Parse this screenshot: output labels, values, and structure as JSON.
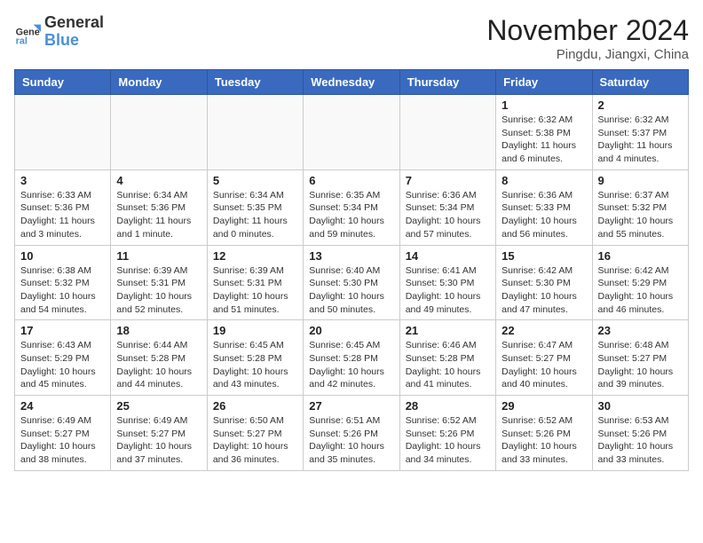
{
  "header": {
    "logo_general": "General",
    "logo_blue": "Blue",
    "month_title": "November 2024",
    "location": "Pingdu, Jiangxi, China"
  },
  "days_of_week": [
    "Sunday",
    "Monday",
    "Tuesday",
    "Wednesday",
    "Thursday",
    "Friday",
    "Saturday"
  ],
  "weeks": [
    [
      {
        "day": "",
        "info": ""
      },
      {
        "day": "",
        "info": ""
      },
      {
        "day": "",
        "info": ""
      },
      {
        "day": "",
        "info": ""
      },
      {
        "day": "",
        "info": ""
      },
      {
        "day": "1",
        "info": "Sunrise: 6:32 AM\nSunset: 5:38 PM\nDaylight: 11 hours and 6 minutes."
      },
      {
        "day": "2",
        "info": "Sunrise: 6:32 AM\nSunset: 5:37 PM\nDaylight: 11 hours and 4 minutes."
      }
    ],
    [
      {
        "day": "3",
        "info": "Sunrise: 6:33 AM\nSunset: 5:36 PM\nDaylight: 11 hours and 3 minutes."
      },
      {
        "day": "4",
        "info": "Sunrise: 6:34 AM\nSunset: 5:36 PM\nDaylight: 11 hours and 1 minute."
      },
      {
        "day": "5",
        "info": "Sunrise: 6:34 AM\nSunset: 5:35 PM\nDaylight: 11 hours and 0 minutes."
      },
      {
        "day": "6",
        "info": "Sunrise: 6:35 AM\nSunset: 5:34 PM\nDaylight: 10 hours and 59 minutes."
      },
      {
        "day": "7",
        "info": "Sunrise: 6:36 AM\nSunset: 5:34 PM\nDaylight: 10 hours and 57 minutes."
      },
      {
        "day": "8",
        "info": "Sunrise: 6:36 AM\nSunset: 5:33 PM\nDaylight: 10 hours and 56 minutes."
      },
      {
        "day": "9",
        "info": "Sunrise: 6:37 AM\nSunset: 5:32 PM\nDaylight: 10 hours and 55 minutes."
      }
    ],
    [
      {
        "day": "10",
        "info": "Sunrise: 6:38 AM\nSunset: 5:32 PM\nDaylight: 10 hours and 54 minutes."
      },
      {
        "day": "11",
        "info": "Sunrise: 6:39 AM\nSunset: 5:31 PM\nDaylight: 10 hours and 52 minutes."
      },
      {
        "day": "12",
        "info": "Sunrise: 6:39 AM\nSunset: 5:31 PM\nDaylight: 10 hours and 51 minutes."
      },
      {
        "day": "13",
        "info": "Sunrise: 6:40 AM\nSunset: 5:30 PM\nDaylight: 10 hours and 50 minutes."
      },
      {
        "day": "14",
        "info": "Sunrise: 6:41 AM\nSunset: 5:30 PM\nDaylight: 10 hours and 49 minutes."
      },
      {
        "day": "15",
        "info": "Sunrise: 6:42 AM\nSunset: 5:30 PM\nDaylight: 10 hours and 47 minutes."
      },
      {
        "day": "16",
        "info": "Sunrise: 6:42 AM\nSunset: 5:29 PM\nDaylight: 10 hours and 46 minutes."
      }
    ],
    [
      {
        "day": "17",
        "info": "Sunrise: 6:43 AM\nSunset: 5:29 PM\nDaylight: 10 hours and 45 minutes."
      },
      {
        "day": "18",
        "info": "Sunrise: 6:44 AM\nSunset: 5:28 PM\nDaylight: 10 hours and 44 minutes."
      },
      {
        "day": "19",
        "info": "Sunrise: 6:45 AM\nSunset: 5:28 PM\nDaylight: 10 hours and 43 minutes."
      },
      {
        "day": "20",
        "info": "Sunrise: 6:45 AM\nSunset: 5:28 PM\nDaylight: 10 hours and 42 minutes."
      },
      {
        "day": "21",
        "info": "Sunrise: 6:46 AM\nSunset: 5:28 PM\nDaylight: 10 hours and 41 minutes."
      },
      {
        "day": "22",
        "info": "Sunrise: 6:47 AM\nSunset: 5:27 PM\nDaylight: 10 hours and 40 minutes."
      },
      {
        "day": "23",
        "info": "Sunrise: 6:48 AM\nSunset: 5:27 PM\nDaylight: 10 hours and 39 minutes."
      }
    ],
    [
      {
        "day": "24",
        "info": "Sunrise: 6:49 AM\nSunset: 5:27 PM\nDaylight: 10 hours and 38 minutes."
      },
      {
        "day": "25",
        "info": "Sunrise: 6:49 AM\nSunset: 5:27 PM\nDaylight: 10 hours and 37 minutes."
      },
      {
        "day": "26",
        "info": "Sunrise: 6:50 AM\nSunset: 5:27 PM\nDaylight: 10 hours and 36 minutes."
      },
      {
        "day": "27",
        "info": "Sunrise: 6:51 AM\nSunset: 5:26 PM\nDaylight: 10 hours and 35 minutes."
      },
      {
        "day": "28",
        "info": "Sunrise: 6:52 AM\nSunset: 5:26 PM\nDaylight: 10 hours and 34 minutes."
      },
      {
        "day": "29",
        "info": "Sunrise: 6:52 AM\nSunset: 5:26 PM\nDaylight: 10 hours and 33 minutes."
      },
      {
        "day": "30",
        "info": "Sunrise: 6:53 AM\nSunset: 5:26 PM\nDaylight: 10 hours and 33 minutes."
      }
    ]
  ]
}
